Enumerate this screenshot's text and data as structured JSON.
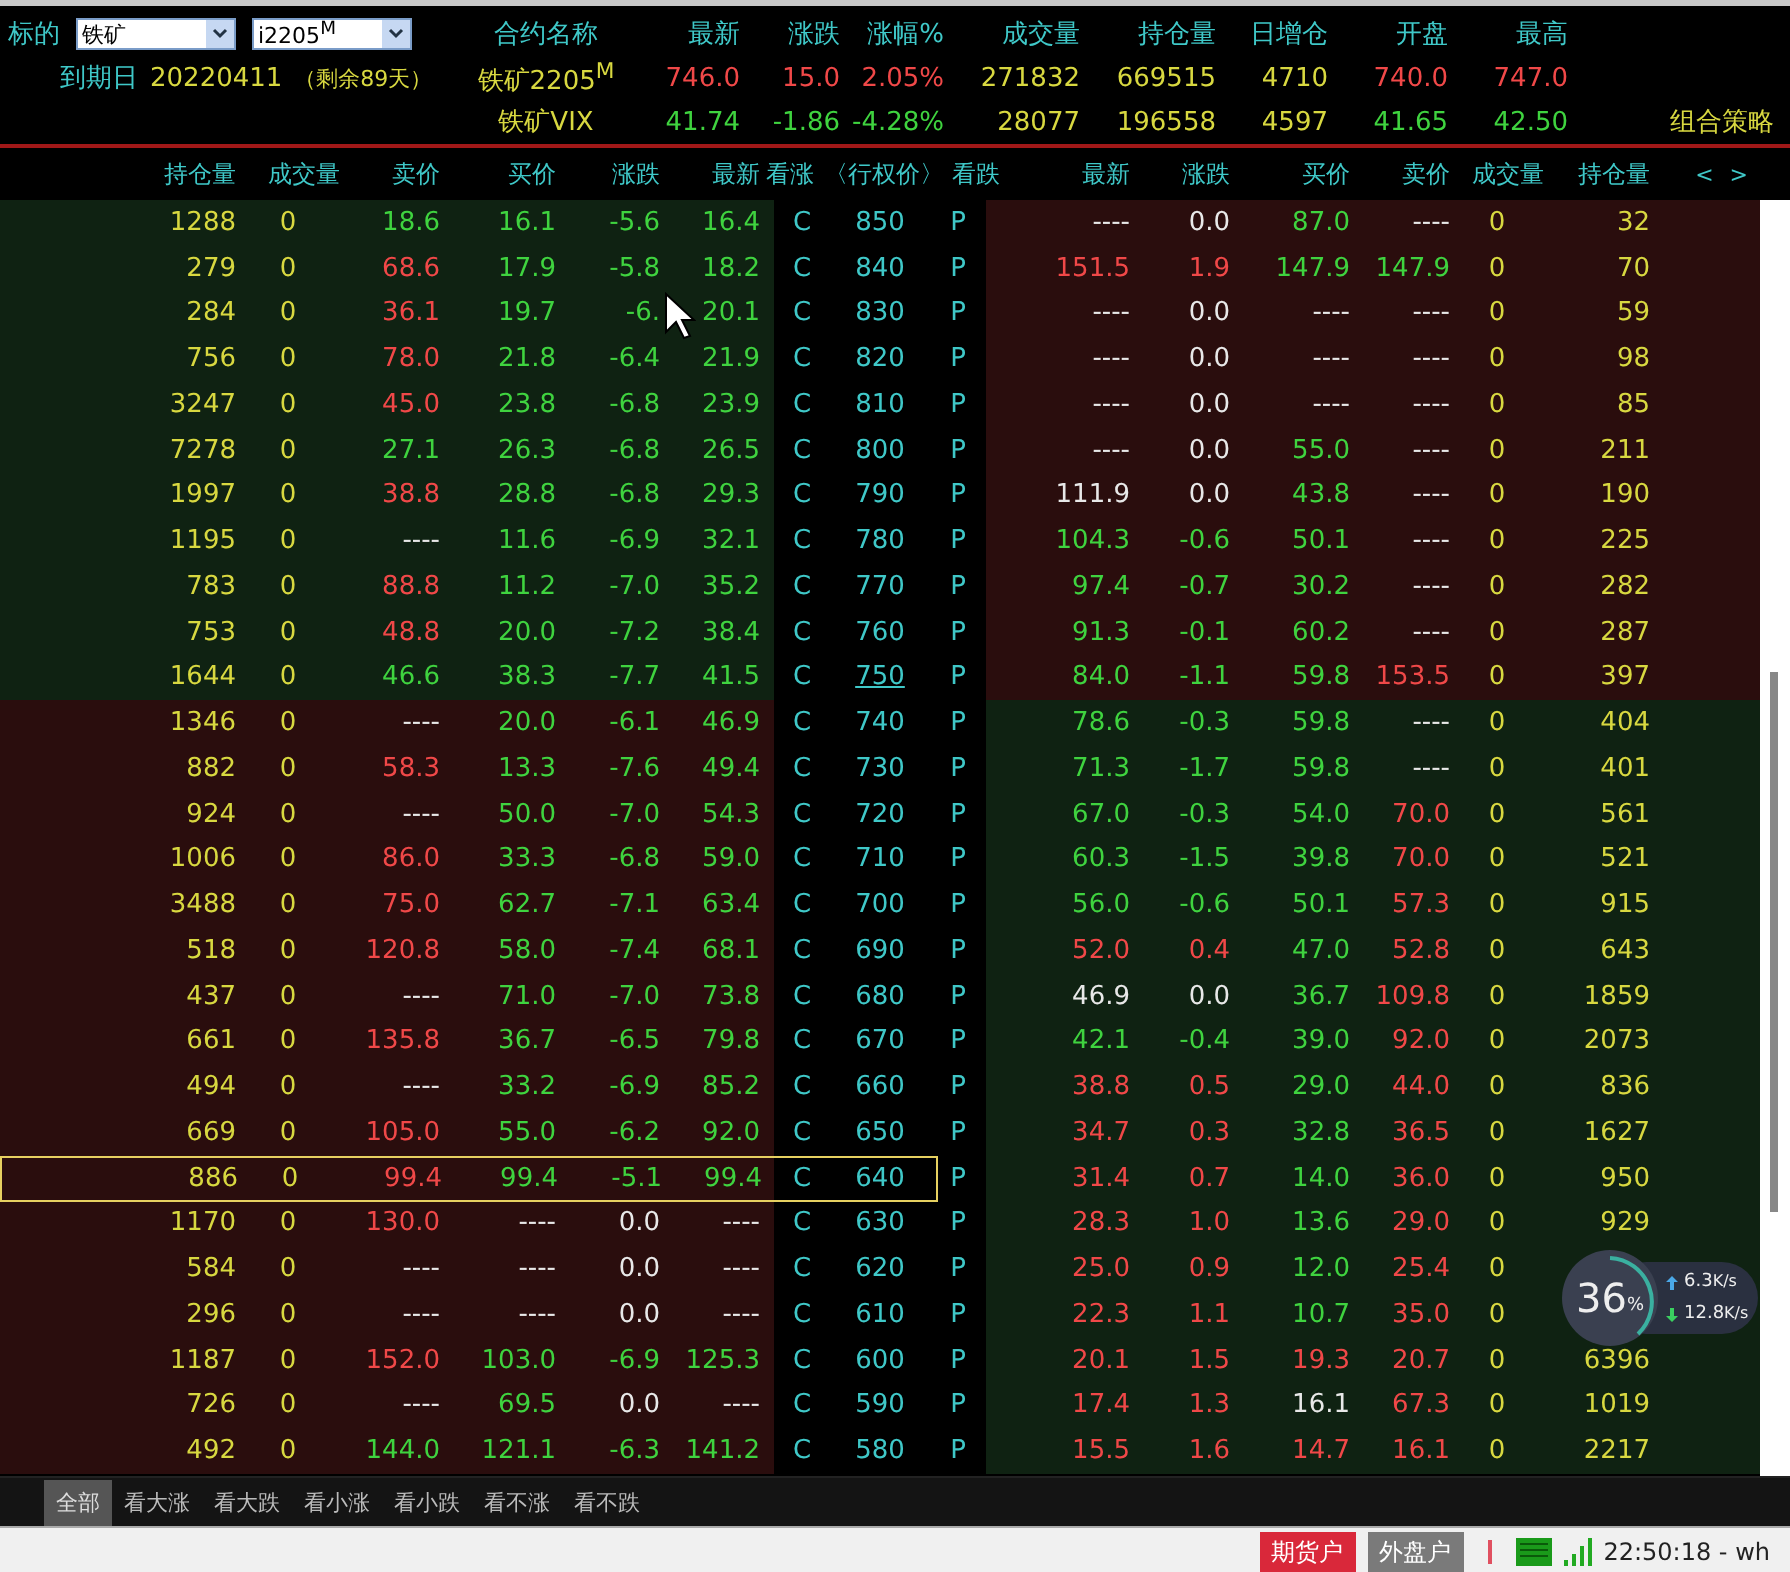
{
  "underlying": {
    "label": "标的",
    "product": "铁矿",
    "contract": "i2205$^{M}$"
  },
  "expiry": {
    "label": "到期日",
    "date": "20220411",
    "remaining": "（剩余89天）"
  },
  "quote_columns": [
    "合约名称",
    "最新",
    "涨跌",
    "涨幅%",
    "成交量",
    "持仓量",
    "日增仓",
    "开盘",
    "最高"
  ],
  "quotes": [
    {
      "name": "铁矿2205$^{M}$",
      "color": "#f04848",
      "values": [
        "746.0",
        "15.0",
        "2.05%",
        "271832",
        "669515",
        "4710",
        "740.0",
        "747.0"
      ]
    },
    {
      "name": "铁矿VIX",
      "color": "#3fd33f",
      "values": [
        "41.74",
        "-1.86",
        "-4.28%",
        "28077",
        "196558",
        "4597",
        "41.65",
        "42.50"
      ]
    }
  ],
  "strategy_link": "组合策略",
  "table_columns": [
    "持仓量",
    "成交量",
    "卖价",
    "买价",
    "涨跌",
    "最新",
    "看涨",
    "〈行权价〉",
    "看跌",
    "最新",
    "涨跌",
    "买价",
    "卖价",
    "成交量",
    "持仓量"
  ],
  "scroll_arrows": [
    "<",
    ">"
  ],
  "rows": [
    {
      "strike": "850",
      "atm": false,
      "call_itm": false,
      "selected": false,
      "c": "C",
      "p": "P",
      "call": [
        {
          "v": "1288"
        },
        {
          "v": "0"
        },
        {
          "v": "18.6",
          "color": "#3fd33f"
        },
        {
          "v": "16.1",
          "color": "#3fd33f"
        },
        {
          "v": "-5.6",
          "color": "#3fd33f"
        },
        {
          "v": "16.4",
          "color": "#3fd33f"
        }
      ],
      "put": [
        {
          "v": "----",
          "color": "#e8e8e8"
        },
        {
          "v": "0.0",
          "color": "#e8e8e8"
        },
        {
          "v": "87.0",
          "color": "#3fd33f"
        },
        {
          "v": "----",
          "color": "#e8e8e8"
        },
        {
          "v": "0"
        },
        {
          "v": "32"
        }
      ]
    },
    {
      "strike": "840",
      "atm": false,
      "call_itm": false,
      "selected": false,
      "c": "C",
      "p": "P",
      "call": [
        {
          "v": "279"
        },
        {
          "v": "0"
        },
        {
          "v": "68.6",
          "color": "#f04848"
        },
        {
          "v": "17.9",
          "color": "#3fd33f"
        },
        {
          "v": "-5.8",
          "color": "#3fd33f"
        },
        {
          "v": "18.2",
          "color": "#3fd33f"
        }
      ],
      "put": [
        {
          "v": "151.5",
          "color": "#f04848"
        },
        {
          "v": "1.9",
          "color": "#f04848"
        },
        {
          "v": "147.9",
          "color": "#3fd33f"
        },
        {
          "v": "147.9",
          "color": "#3fd33f"
        },
        {
          "v": "0"
        },
        {
          "v": "70"
        }
      ]
    },
    {
      "strike": "830",
      "atm": false,
      "call_itm": false,
      "selected": false,
      "c": "C",
      "p": "P",
      "call": [
        {
          "v": "284"
        },
        {
          "v": "0"
        },
        {
          "v": "36.1",
          "color": "#f04848"
        },
        {
          "v": "19.7",
          "color": "#3fd33f"
        },
        {
          "v": "-6.",
          "color": "#3fd33f"
        },
        {
          "v": "20.1",
          "color": "#3fd33f"
        }
      ],
      "put": [
        {
          "v": "----",
          "color": "#e8e8e8"
        },
        {
          "v": "0.0",
          "color": "#e8e8e8"
        },
        {
          "v": "----",
          "color": "#e8e8e8"
        },
        {
          "v": "----",
          "color": "#e8e8e8"
        },
        {
          "v": "0"
        },
        {
          "v": "59"
        }
      ]
    },
    {
      "strike": "820",
      "atm": false,
      "call_itm": false,
      "selected": false,
      "c": "C",
      "p": "P",
      "call": [
        {
          "v": "756"
        },
        {
          "v": "0"
        },
        {
          "v": "78.0",
          "color": "#f04848"
        },
        {
          "v": "21.8",
          "color": "#3fd33f"
        },
        {
          "v": "-6.4",
          "color": "#3fd33f"
        },
        {
          "v": "21.9",
          "color": "#3fd33f"
        }
      ],
      "put": [
        {
          "v": "----",
          "color": "#e8e8e8"
        },
        {
          "v": "0.0",
          "color": "#e8e8e8"
        },
        {
          "v": "----",
          "color": "#e8e8e8"
        },
        {
          "v": "----",
          "color": "#e8e8e8"
        },
        {
          "v": "0"
        },
        {
          "v": "98"
        }
      ]
    },
    {
      "strike": "810",
      "atm": false,
      "call_itm": false,
      "selected": false,
      "c": "C",
      "p": "P",
      "call": [
        {
          "v": "3247"
        },
        {
          "v": "0"
        },
        {
          "v": "45.0",
          "color": "#f04848"
        },
        {
          "v": "23.8",
          "color": "#3fd33f"
        },
        {
          "v": "-6.8",
          "color": "#3fd33f"
        },
        {
          "v": "23.9",
          "color": "#3fd33f"
        }
      ],
      "put": [
        {
          "v": "----",
          "color": "#e8e8e8"
        },
        {
          "v": "0.0",
          "color": "#e8e8e8"
        },
        {
          "v": "----",
          "color": "#e8e8e8"
        },
        {
          "v": "----",
          "color": "#e8e8e8"
        },
        {
          "v": "0"
        },
        {
          "v": "85"
        }
      ]
    },
    {
      "strike": "800",
      "atm": false,
      "call_itm": false,
      "selected": false,
      "c": "C",
      "p": "P",
      "call": [
        {
          "v": "7278"
        },
        {
          "v": "0"
        },
        {
          "v": "27.1",
          "color": "#3fd33f"
        },
        {
          "v": "26.3",
          "color": "#3fd33f"
        },
        {
          "v": "-6.8",
          "color": "#3fd33f"
        },
        {
          "v": "26.5",
          "color": "#3fd33f"
        }
      ],
      "put": [
        {
          "v": "----",
          "color": "#e8e8e8"
        },
        {
          "v": "0.0",
          "color": "#e8e8e8"
        },
        {
          "v": "55.0",
          "color": "#3fd33f"
        },
        {
          "v": "----",
          "color": "#e8e8e8"
        },
        {
          "v": "0"
        },
        {
          "v": "211"
        }
      ]
    },
    {
      "strike": "790",
      "atm": false,
      "call_itm": false,
      "selected": false,
      "c": "C",
      "p": "P",
      "call": [
        {
          "v": "1997"
        },
        {
          "v": "0"
        },
        {
          "v": "38.8",
          "color": "#f04848"
        },
        {
          "v": "28.8",
          "color": "#3fd33f"
        },
        {
          "v": "-6.8",
          "color": "#3fd33f"
        },
        {
          "v": "29.3",
          "color": "#3fd33f"
        }
      ],
      "put": [
        {
          "v": "111.9",
          "color": "#e8e8e8"
        },
        {
          "v": "0.0",
          "color": "#e8e8e8"
        },
        {
          "v": "43.8",
          "color": "#3fd33f"
        },
        {
          "v": "----",
          "color": "#e8e8e8"
        },
        {
          "v": "0"
        },
        {
          "v": "190"
        }
      ]
    },
    {
      "strike": "780",
      "atm": false,
      "call_itm": false,
      "selected": false,
      "c": "C",
      "p": "P",
      "call": [
        {
          "v": "1195"
        },
        {
          "v": "0"
        },
        {
          "v": "----",
          "color": "#e8e8e8"
        },
        {
          "v": "11.6",
          "color": "#3fd33f"
        },
        {
          "v": "-6.9",
          "color": "#3fd33f"
        },
        {
          "v": "32.1",
          "color": "#3fd33f"
        }
      ],
      "put": [
        {
          "v": "104.3",
          "color": "#3fd33f"
        },
        {
          "v": "-0.6",
          "color": "#3fd33f"
        },
        {
          "v": "50.1",
          "color": "#3fd33f"
        },
        {
          "v": "----",
          "color": "#e8e8e8"
        },
        {
          "v": "0"
        },
        {
          "v": "225"
        }
      ]
    },
    {
      "strike": "770",
      "atm": false,
      "call_itm": false,
      "selected": false,
      "c": "C",
      "p": "P",
      "call": [
        {
          "v": "783"
        },
        {
          "v": "0"
        },
        {
          "v": "88.8",
          "color": "#f04848"
        },
        {
          "v": "11.2",
          "color": "#3fd33f"
        },
        {
          "v": "-7.0",
          "color": "#3fd33f"
        },
        {
          "v": "35.2",
          "color": "#3fd33f"
        }
      ],
      "put": [
        {
          "v": "97.4",
          "color": "#3fd33f"
        },
        {
          "v": "-0.7",
          "color": "#3fd33f"
        },
        {
          "v": "30.2",
          "color": "#3fd33f"
        },
        {
          "v": "----",
          "color": "#e8e8e8"
        },
        {
          "v": "0"
        },
        {
          "v": "282"
        }
      ]
    },
    {
      "strike": "760",
      "atm": false,
      "call_itm": false,
      "selected": false,
      "c": "C",
      "p": "P",
      "call": [
        {
          "v": "753"
        },
        {
          "v": "0"
        },
        {
          "v": "48.8",
          "color": "#f04848"
        },
        {
          "v": "20.0",
          "color": "#3fd33f"
        },
        {
          "v": "-7.2",
          "color": "#3fd33f"
        },
        {
          "v": "38.4",
          "color": "#3fd33f"
        }
      ],
      "put": [
        {
          "v": "91.3",
          "color": "#3fd33f"
        },
        {
          "v": "-0.1",
          "color": "#3fd33f"
        },
        {
          "v": "60.2",
          "color": "#3fd33f"
        },
        {
          "v": "----",
          "color": "#e8e8e8"
        },
        {
          "v": "0"
        },
        {
          "v": "287"
        }
      ]
    },
    {
      "strike": "750",
      "atm": true,
      "call_itm": false,
      "selected": false,
      "c": "C",
      "p": "P",
      "call": [
        {
          "v": "1644"
        },
        {
          "v": "0"
        },
        {
          "v": "46.6",
          "color": "#3fd33f"
        },
        {
          "v": "38.3",
          "color": "#3fd33f"
        },
        {
          "v": "-7.7",
          "color": "#3fd33f"
        },
        {
          "v": "41.5",
          "color": "#3fd33f"
        }
      ],
      "put": [
        {
          "v": "84.0",
          "color": "#3fd33f"
        },
        {
          "v": "-1.1",
          "color": "#3fd33f"
        },
        {
          "v": "59.8",
          "color": "#3fd33f"
        },
        {
          "v": "153.5",
          "color": "#f04848"
        },
        {
          "v": "0"
        },
        {
          "v": "397"
        }
      ]
    },
    {
      "strike": "740",
      "atm": false,
      "call_itm": true,
      "selected": false,
      "c": "C",
      "p": "P",
      "call": [
        {
          "v": "1346"
        },
        {
          "v": "0"
        },
        {
          "v": "----",
          "color": "#e8e8e8"
        },
        {
          "v": "20.0",
          "color": "#3fd33f"
        },
        {
          "v": "-6.1",
          "color": "#3fd33f"
        },
        {
          "v": "46.9",
          "color": "#3fd33f"
        }
      ],
      "put": [
        {
          "v": "78.6",
          "color": "#3fd33f"
        },
        {
          "v": "-0.3",
          "color": "#3fd33f"
        },
        {
          "v": "59.8",
          "color": "#3fd33f"
        },
        {
          "v": "----",
          "color": "#e8e8e8"
        },
        {
          "v": "0"
        },
        {
          "v": "404"
        }
      ]
    },
    {
      "strike": "730",
      "atm": false,
      "call_itm": true,
      "selected": false,
      "c": "C",
      "p": "P",
      "call": [
        {
          "v": "882"
        },
        {
          "v": "0"
        },
        {
          "v": "58.3",
          "color": "#f04848"
        },
        {
          "v": "13.3",
          "color": "#3fd33f"
        },
        {
          "v": "-7.6",
          "color": "#3fd33f"
        },
        {
          "v": "49.4",
          "color": "#3fd33f"
        }
      ],
      "put": [
        {
          "v": "71.3",
          "color": "#3fd33f"
        },
        {
          "v": "-1.7",
          "color": "#3fd33f"
        },
        {
          "v": "59.8",
          "color": "#3fd33f"
        },
        {
          "v": "----",
          "color": "#e8e8e8"
        },
        {
          "v": "0"
        },
        {
          "v": "401"
        }
      ]
    },
    {
      "strike": "720",
      "atm": false,
      "call_itm": true,
      "selected": false,
      "c": "C",
      "p": "P",
      "call": [
        {
          "v": "924"
        },
        {
          "v": "0"
        },
        {
          "v": "----",
          "color": "#e8e8e8"
        },
        {
          "v": "50.0",
          "color": "#3fd33f"
        },
        {
          "v": "-7.0",
          "color": "#3fd33f"
        },
        {
          "v": "54.3",
          "color": "#3fd33f"
        }
      ],
      "put": [
        {
          "v": "67.0",
          "color": "#3fd33f"
        },
        {
          "v": "-0.3",
          "color": "#3fd33f"
        },
        {
          "v": "54.0",
          "color": "#3fd33f"
        },
        {
          "v": "70.0",
          "color": "#f04848"
        },
        {
          "v": "0"
        },
        {
          "v": "561"
        }
      ]
    },
    {
      "strike": "710",
      "atm": false,
      "call_itm": true,
      "selected": false,
      "c": "C",
      "p": "P",
      "call": [
        {
          "v": "1006"
        },
        {
          "v": "0"
        },
        {
          "v": "86.0",
          "color": "#f04848"
        },
        {
          "v": "33.3",
          "color": "#3fd33f"
        },
        {
          "v": "-6.8",
          "color": "#3fd33f"
        },
        {
          "v": "59.0",
          "color": "#3fd33f"
        }
      ],
      "put": [
        {
          "v": "60.3",
          "color": "#3fd33f"
        },
        {
          "v": "-1.5",
          "color": "#3fd33f"
        },
        {
          "v": "39.8",
          "color": "#3fd33f"
        },
        {
          "v": "70.0",
          "color": "#f04848"
        },
        {
          "v": "0"
        },
        {
          "v": "521"
        }
      ]
    },
    {
      "strike": "700",
      "atm": false,
      "call_itm": true,
      "selected": false,
      "c": "C",
      "p": "P",
      "call": [
        {
          "v": "3488"
        },
        {
          "v": "0"
        },
        {
          "v": "75.0",
          "color": "#f04848"
        },
        {
          "v": "62.7",
          "color": "#3fd33f"
        },
        {
          "v": "-7.1",
          "color": "#3fd33f"
        },
        {
          "v": "63.4",
          "color": "#3fd33f"
        }
      ],
      "put": [
        {
          "v": "56.0",
          "color": "#3fd33f"
        },
        {
          "v": "-0.6",
          "color": "#3fd33f"
        },
        {
          "v": "50.1",
          "color": "#3fd33f"
        },
        {
          "v": "57.3",
          "color": "#f04848"
        },
        {
          "v": "0"
        },
        {
          "v": "915"
        }
      ]
    },
    {
      "strike": "690",
      "atm": false,
      "call_itm": true,
      "selected": false,
      "c": "C",
      "p": "P",
      "call": [
        {
          "v": "518"
        },
        {
          "v": "0"
        },
        {
          "v": "120.8",
          "color": "#f04848"
        },
        {
          "v": "58.0",
          "color": "#3fd33f"
        },
        {
          "v": "-7.4",
          "color": "#3fd33f"
        },
        {
          "v": "68.1",
          "color": "#3fd33f"
        }
      ],
      "put": [
        {
          "v": "52.0",
          "color": "#f04848"
        },
        {
          "v": "0.4",
          "color": "#f04848"
        },
        {
          "v": "47.0",
          "color": "#3fd33f"
        },
        {
          "v": "52.8",
          "color": "#f04848"
        },
        {
          "v": "0"
        },
        {
          "v": "643"
        }
      ]
    },
    {
      "strike": "680",
      "atm": false,
      "call_itm": true,
      "selected": false,
      "c": "C",
      "p": "P",
      "call": [
        {
          "v": "437"
        },
        {
          "v": "0"
        },
        {
          "v": "----",
          "color": "#e8e8e8"
        },
        {
          "v": "71.0",
          "color": "#3fd33f"
        },
        {
          "v": "-7.0",
          "color": "#3fd33f"
        },
        {
          "v": "73.8",
          "color": "#3fd33f"
        }
      ],
      "put": [
        {
          "v": "46.9",
          "color": "#e8e8e8"
        },
        {
          "v": "0.0",
          "color": "#e8e8e8"
        },
        {
          "v": "36.7",
          "color": "#3fd33f"
        },
        {
          "v": "109.8",
          "color": "#f04848"
        },
        {
          "v": "0"
        },
        {
          "v": "1859"
        }
      ]
    },
    {
      "strike": "670",
      "atm": false,
      "call_itm": true,
      "selected": false,
      "c": "C",
      "p": "P",
      "call": [
        {
          "v": "661"
        },
        {
          "v": "0"
        },
        {
          "v": "135.8",
          "color": "#f04848"
        },
        {
          "v": "36.7",
          "color": "#3fd33f"
        },
        {
          "v": "-6.5",
          "color": "#3fd33f"
        },
        {
          "v": "79.8",
          "color": "#3fd33f"
        }
      ],
      "put": [
        {
          "v": "42.1",
          "color": "#3fd33f"
        },
        {
          "v": "-0.4",
          "color": "#3fd33f"
        },
        {
          "v": "39.0",
          "color": "#3fd33f"
        },
        {
          "v": "92.0",
          "color": "#f04848"
        },
        {
          "v": "0"
        },
        {
          "v": "2073"
        }
      ]
    },
    {
      "strike": "660",
      "atm": false,
      "call_itm": true,
      "selected": false,
      "c": "C",
      "p": "P",
      "call": [
        {
          "v": "494"
        },
        {
          "v": "0"
        },
        {
          "v": "----",
          "color": "#e8e8e8"
        },
        {
          "v": "33.2",
          "color": "#3fd33f"
        },
        {
          "v": "-6.9",
          "color": "#3fd33f"
        },
        {
          "v": "85.2",
          "color": "#3fd33f"
        }
      ],
      "put": [
        {
          "v": "38.8",
          "color": "#f04848"
        },
        {
          "v": "0.5",
          "color": "#f04848"
        },
        {
          "v": "29.0",
          "color": "#3fd33f"
        },
        {
          "v": "44.0",
          "color": "#f04848"
        },
        {
          "v": "0"
        },
        {
          "v": "836"
        }
      ]
    },
    {
      "strike": "650",
      "atm": false,
      "call_itm": true,
      "selected": false,
      "c": "C",
      "p": "P",
      "call": [
        {
          "v": "669"
        },
        {
          "v": "0"
        },
        {
          "v": "105.0",
          "color": "#f04848"
        },
        {
          "v": "55.0",
          "color": "#3fd33f"
        },
        {
          "v": "-6.2",
          "color": "#3fd33f"
        },
        {
          "v": "92.0",
          "color": "#3fd33f"
        }
      ],
      "put": [
        {
          "v": "34.7",
          "color": "#f04848"
        },
        {
          "v": "0.3",
          "color": "#f04848"
        },
        {
          "v": "32.8",
          "color": "#3fd33f"
        },
        {
          "v": "36.5",
          "color": "#f04848"
        },
        {
          "v": "0"
        },
        {
          "v": "1627"
        }
      ]
    },
    {
      "strike": "640",
      "atm": false,
      "call_itm": true,
      "selected": true,
      "c": "C",
      "p": "P",
      "call": [
        {
          "v": "886"
        },
        {
          "v": "0"
        },
        {
          "v": "99.4",
          "color": "#f04848"
        },
        {
          "v": "99.4",
          "color": "#3fd33f"
        },
        {
          "v": "-5.1",
          "color": "#3fd33f"
        },
        {
          "v": "99.4",
          "color": "#3fd33f"
        }
      ],
      "put": [
        {
          "v": "31.4",
          "color": "#f04848"
        },
        {
          "v": "0.7",
          "color": "#f04848"
        },
        {
          "v": "14.0",
          "color": "#3fd33f"
        },
        {
          "v": "36.0",
          "color": "#f04848"
        },
        {
          "v": "0"
        },
        {
          "v": "950"
        }
      ]
    },
    {
      "strike": "630",
      "atm": false,
      "call_itm": true,
      "selected": false,
      "c": "C",
      "p": "P",
      "call": [
        {
          "v": "1170"
        },
        {
          "v": "0"
        },
        {
          "v": "130.0",
          "color": "#f04848"
        },
        {
          "v": "----",
          "color": "#e8e8e8"
        },
        {
          "v": "0.0",
          "color": "#e8e8e8"
        },
        {
          "v": "----",
          "color": "#e8e8e8"
        }
      ],
      "put": [
        {
          "v": "28.3",
          "color": "#f04848"
        },
        {
          "v": "1.0",
          "color": "#f04848"
        },
        {
          "v": "13.6",
          "color": "#3fd33f"
        },
        {
          "v": "29.0",
          "color": "#f04848"
        },
        {
          "v": "0"
        },
        {
          "v": "929"
        }
      ]
    },
    {
      "strike": "620",
      "atm": false,
      "call_itm": true,
      "selected": false,
      "c": "C",
      "p": "P",
      "call": [
        {
          "v": "584"
        },
        {
          "v": "0"
        },
        {
          "v": "----",
          "color": "#e8e8e8"
        },
        {
          "v": "----",
          "color": "#e8e8e8"
        },
        {
          "v": "0.0",
          "color": "#e8e8e8"
        },
        {
          "v": "----",
          "color": "#e8e8e8"
        }
      ],
      "put": [
        {
          "v": "25.0",
          "color": "#f04848"
        },
        {
          "v": "0.9",
          "color": "#f04848"
        },
        {
          "v": "12.0",
          "color": "#3fd33f"
        },
        {
          "v": "25.4",
          "color": "#f04848"
        },
        {
          "v": "0"
        }
      ]
    },
    {
      "strike": "610",
      "atm": false,
      "call_itm": true,
      "selected": false,
      "c": "C",
      "p": "P",
      "call": [
        {
          "v": "296"
        },
        {
          "v": "0"
        },
        {
          "v": "----",
          "color": "#e8e8e8"
        },
        {
          "v": "----",
          "color": "#e8e8e8"
        },
        {
          "v": "0.0",
          "color": "#e8e8e8"
        },
        {
          "v": "----",
          "color": "#e8e8e8"
        }
      ],
      "put": [
        {
          "v": "22.3",
          "color": "#f04848"
        },
        {
          "v": "1.1",
          "color": "#f04848"
        },
        {
          "v": "10.7",
          "color": "#3fd33f"
        },
        {
          "v": "35.0",
          "color": "#f04848"
        },
        {
          "v": "0"
        }
      ]
    },
    {
      "strike": "600",
      "atm": false,
      "call_itm": true,
      "selected": false,
      "c": "C",
      "p": "P",
      "call": [
        {
          "v": "1187"
        },
        {
          "v": "0"
        },
        {
          "v": "152.0",
          "color": "#f04848"
        },
        {
          "v": "103.0",
          "color": "#3fd33f"
        },
        {
          "v": "-6.9",
          "color": "#3fd33f"
        },
        {
          "v": "125.3",
          "color": "#3fd33f"
        }
      ],
      "put": [
        {
          "v": "20.1",
          "color": "#f04848"
        },
        {
          "v": "1.5",
          "color": "#f04848"
        },
        {
          "v": "19.3",
          "color": "#f04848"
        },
        {
          "v": "20.7",
          "color": "#f04848"
        },
        {
          "v": "0"
        },
        {
          "v": "6396"
        }
      ]
    },
    {
      "strike": "590",
      "atm": false,
      "call_itm": true,
      "selected": false,
      "c": "C",
      "p": "P",
      "call": [
        {
          "v": "726"
        },
        {
          "v": "0"
        },
        {
          "v": "----",
          "color": "#e8e8e8"
        },
        {
          "v": "69.5",
          "color": "#3fd33f"
        },
        {
          "v": "0.0",
          "color": "#e8e8e8"
        },
        {
          "v": "----",
          "color": "#e8e8e8"
        }
      ],
      "put": [
        {
          "v": "17.4",
          "color": "#f04848"
        },
        {
          "v": "1.3",
          "color": "#f04848"
        },
        {
          "v": "16.1",
          "color": "#e8e8e8"
        },
        {
          "v": "67.3",
          "color": "#f04848"
        },
        {
          "v": "0"
        },
        {
          "v": "1019"
        }
      ]
    },
    {
      "strike": "580",
      "atm": false,
      "call_itm": true,
      "selected": false,
      "c": "C",
      "p": "P",
      "call": [
        {
          "v": "492"
        },
        {
          "v": "0"
        },
        {
          "v": "144.0",
          "color": "#3fd33f"
        },
        {
          "v": "121.1",
          "color": "#3fd33f"
        },
        {
          "v": "-6.3",
          "color": "#3fd33f"
        },
        {
          "v": "141.2",
          "color": "#3fd33f"
        }
      ],
      "put": [
        {
          "v": "15.5",
          "color": "#f04848"
        },
        {
          "v": "1.6",
          "color": "#f04848"
        },
        {
          "v": "14.7",
          "color": "#f04848"
        },
        {
          "v": "16.1",
          "color": "#f04848"
        },
        {
          "v": "0"
        },
        {
          "v": "2217"
        }
      ]
    }
  ],
  "filter_tabs": [
    {
      "label": "全部",
      "selected": true
    },
    {
      "label": "看大涨",
      "selected": false
    },
    {
      "label": "看大跌",
      "selected": false
    },
    {
      "label": "看小涨",
      "selected": false
    },
    {
      "label": "看小跌",
      "selected": false
    },
    {
      "label": "看不涨",
      "selected": false
    },
    {
      "label": "看不跌",
      "selected": false
    }
  ],
  "net_widget": {
    "percent": "36",
    "unit": "%",
    "up": {
      "value": "6.3",
      "unit": "K/s"
    },
    "down": {
      "value": "12.8",
      "unit": "K/s"
    }
  },
  "status_bar": {
    "accounts": [
      {
        "label": "期货户",
        "color": "#d9283a"
      },
      {
        "label": "外盘户",
        "color": "#7a7a7a"
      }
    ],
    "time": "22:50:18 - wh"
  }
}
